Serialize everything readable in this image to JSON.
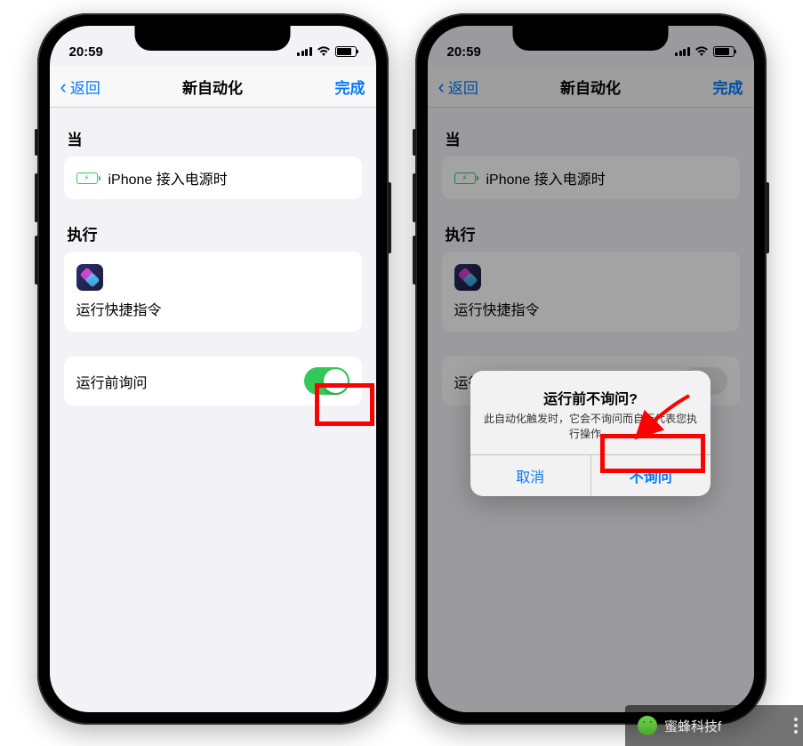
{
  "status": {
    "time": "20:59"
  },
  "nav": {
    "back": "返回",
    "title": "新自动化",
    "done": "完成"
  },
  "section_when": {
    "header": "当",
    "trigger_text": "iPhone 接入电源时"
  },
  "section_do": {
    "header": "执行",
    "action_text": "运行快捷指令"
  },
  "ask_row": {
    "label": "运行前询问",
    "label_truncated": "运行"
  },
  "alert": {
    "title": "运行前不询问?",
    "message": "此自动化触发时，它会不询问而自行代表您执行操作。",
    "cancel": "取消",
    "confirm": "不询问"
  },
  "watermark": {
    "text": "蜜蜂科技f"
  }
}
